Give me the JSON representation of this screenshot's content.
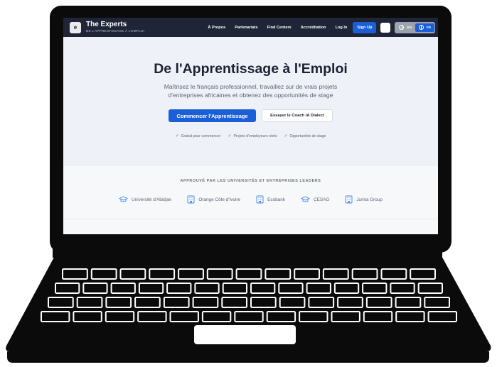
{
  "brand": {
    "logo_text": "e",
    "name": "The Experts",
    "tagline": "DE L'APPRENTISSAGE À L'EMPLOI"
  },
  "nav": {
    "links": [
      "À Propos",
      "Partenariats",
      "Find Centers",
      "Accréditation",
      "Log In"
    ],
    "signup": "Sign Up",
    "languages": [
      {
        "code": "EN",
        "active": false
      },
      {
        "code": "FR",
        "active": true
      }
    ]
  },
  "hero": {
    "title": "De l'Apprentissage à l'Emploi",
    "subtitle": "Maîtrisez le français professionnel, travaillez sur de vrais projets d'entreprises africaines et obtenez des opportunités de stage",
    "cta_primary": "Commencer l'Apprentissage",
    "cta_secondary": "Essayer le Coach IA Dialect",
    "checks": [
      "Gratuit pour commencer",
      "Projets d'employeurs réels",
      "Opportunités de stage"
    ]
  },
  "partners": {
    "title": "APPROUVÉ PAR LES UNIVERSITÉS ET ENTREPRISES LEADERS",
    "items": [
      {
        "name": "Université d'Abidjan",
        "icon": "graduation-cap-icon"
      },
      {
        "name": "Orange Côte d'Ivoire",
        "icon": "building-icon"
      },
      {
        "name": "Ecobank",
        "icon": "building-icon"
      },
      {
        "name": "CESAG",
        "icon": "graduation-cap-icon"
      },
      {
        "name": "Jumia Group",
        "icon": "building-icon"
      }
    ]
  },
  "colors": {
    "nav_bg": "#1f2537",
    "accent": "#1b5fd8",
    "hero_bg": "#eef1f7",
    "icon_blue": "#3b82f6"
  }
}
